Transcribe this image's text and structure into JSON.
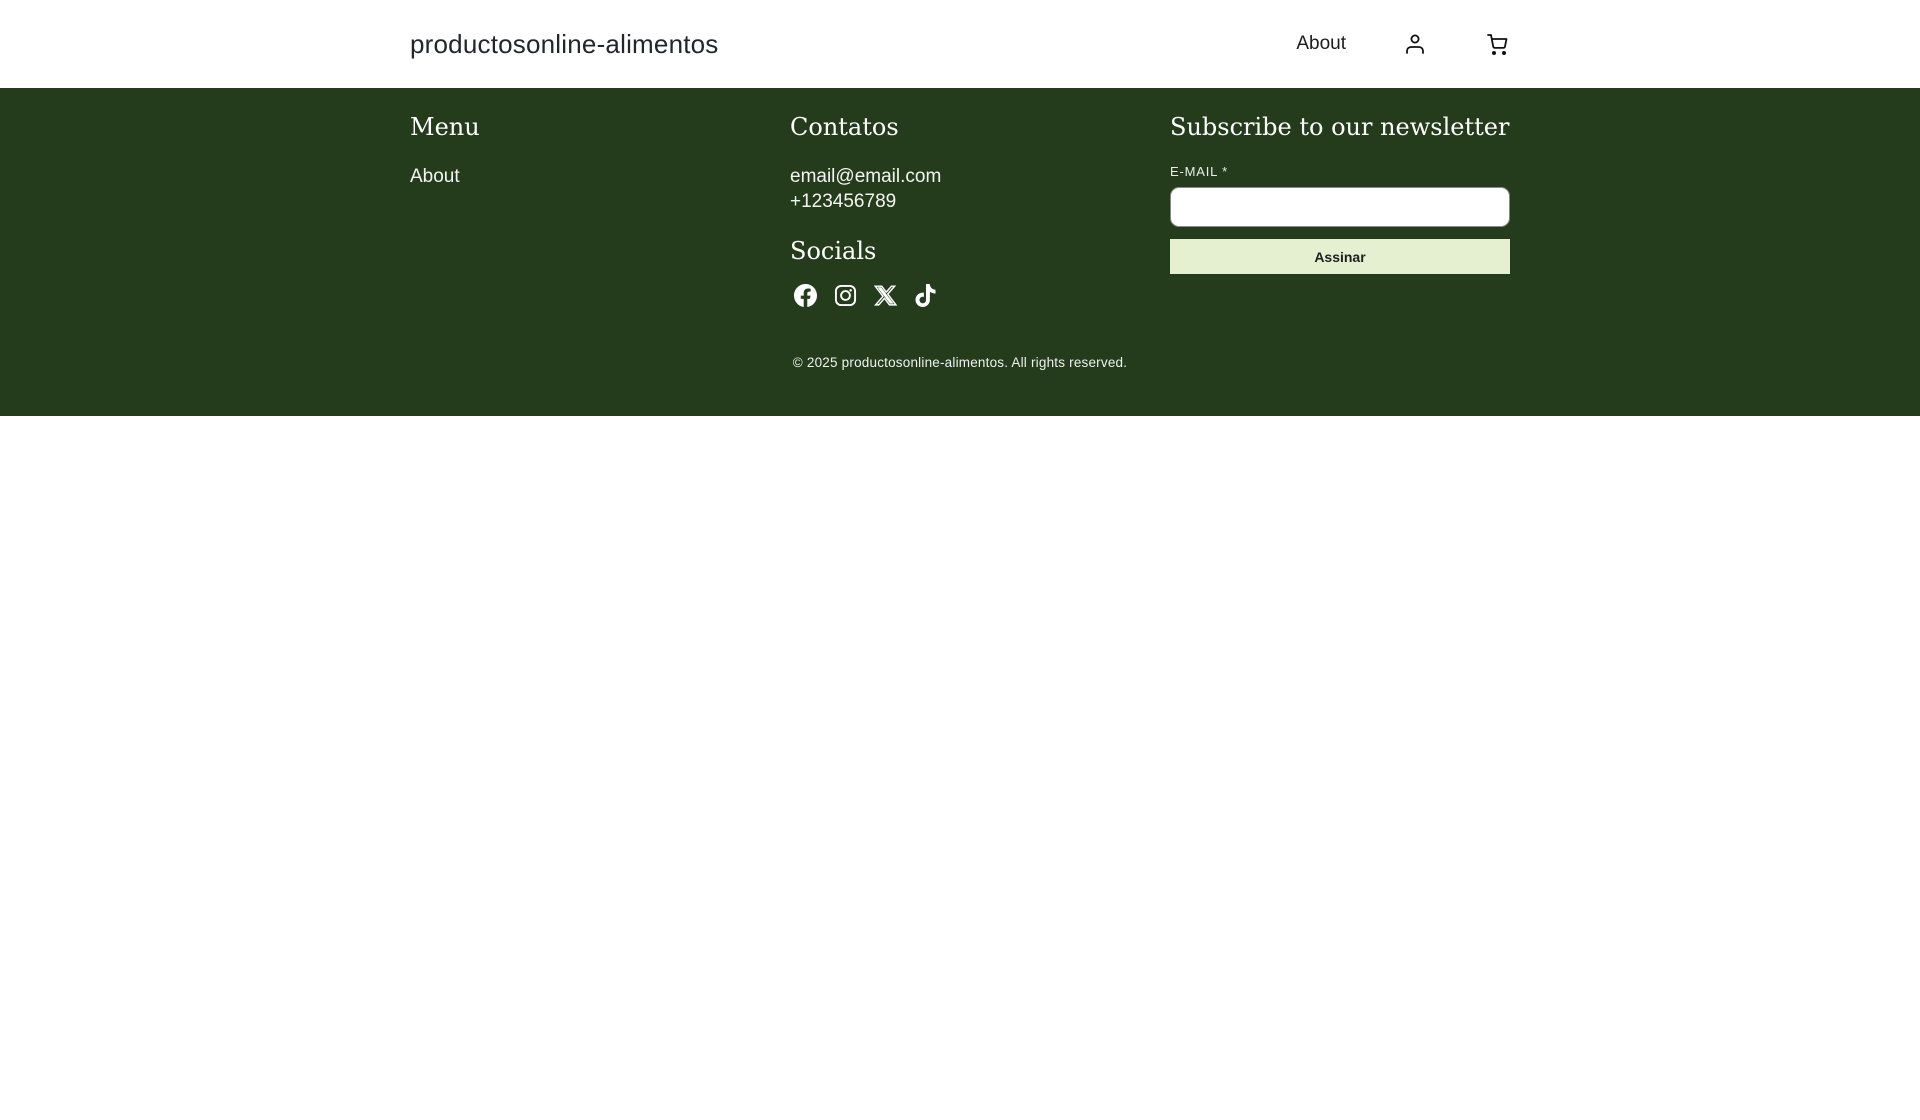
{
  "header": {
    "logo": "productosonline-alimentos",
    "nav": {
      "about_label": "About"
    },
    "icons": {
      "account": "account-icon",
      "cart": "shopping-cart-icon"
    }
  },
  "footer": {
    "menu": {
      "heading": "Menu",
      "about_link": "About"
    },
    "contacts": {
      "heading": "Contatos",
      "email": "email@email.com",
      "phone": "+123456789"
    },
    "socials": {
      "heading": "Socials",
      "icons": [
        "facebook",
        "instagram",
        "x",
        "tiktok"
      ]
    },
    "newsletter": {
      "heading": "Subscribe to our newsletter",
      "email_label": "E-MAIL *",
      "email_value": "",
      "button_label": "Assinar"
    },
    "copyright": "© 2025 productosonline-alimentos. All rights reserved."
  },
  "colors": {
    "header_bg": "#ffffff",
    "header_text": "#23262d",
    "footer_bg": "#243c1b",
    "footer_text": "#f7f7f5",
    "subscribe_button_bg": "#e4f0d0"
  }
}
